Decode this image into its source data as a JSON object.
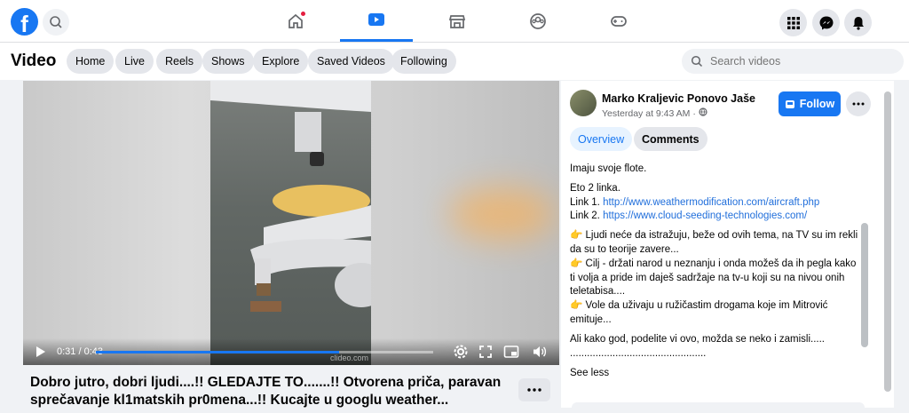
{
  "app": {
    "logo_letter": "f",
    "nav_tabs": [
      {
        "name": "home",
        "icon": "home-icon",
        "active": false,
        "notification": true
      },
      {
        "name": "video",
        "icon": "video-icon",
        "active": true
      },
      {
        "name": "marketplace",
        "icon": "marketplace-icon",
        "active": false
      },
      {
        "name": "groups",
        "icon": "groups-icon",
        "active": false
      },
      {
        "name": "gaming",
        "icon": "gaming-icon",
        "active": false
      }
    ],
    "right_icons": [
      "menu-grid-icon",
      "messenger-icon",
      "bell-icon"
    ]
  },
  "video_nav": {
    "title": "Video",
    "pills": [
      "Home",
      "Live",
      "Reels",
      "Shows",
      "Explore",
      "Saved Videos",
      "Following"
    ],
    "search_placeholder": "Search videos"
  },
  "player": {
    "time": "0:31 / 0:43",
    "progress_percent": 72,
    "watermark": "clideo.com"
  },
  "video_title": "Dobro jutro, dobri ljudi....!! GLEDAJTE TO.......!! Otvorena priča, paravan sprečavanje kl1matskih pr0mena...!! Kucajte u googlu weather...",
  "sidebar": {
    "author": "Marko Kraljevic Ponovo Jaše",
    "meta": "Yesterday at 9:43 AM ·",
    "follow_label": "Follow",
    "tabs": [
      "Overview",
      "Comments"
    ],
    "description": {
      "line1": "Imaju svoje flote.",
      "line2": "Eto 2 linka.",
      "link1_prefix": "Link 1.",
      "link1": "http://www.weathermodification.com/aircraft.php",
      "link2_prefix": "Link 2.",
      "link2": "https://www.cloud-seeding-technologies.com/",
      "bullet1": "👉 Ljudi neće da istražuju, beže od ovih tema, na TV su im rekli da su to teorije zavere...",
      "bullet2": "👉 Cilj - držati narod u neznanju i onda možeš da ih pegla kako ti volja a pride im daješ sadržaje na tv-u koji su na nivou onih teletabisa....",
      "bullet3": "👉 Vole da uživaju u ružičastim drogama koje im Mitrović emituje...",
      "line3": "Ali kako god, podelite vi ovo, možda se neko i zamisli.....",
      "dots1": "................................................",
      "dots2": "..........................................."
    },
    "see_less": "See less"
  },
  "colors": {
    "accent": "#1877f2",
    "notification": "#e41e3f"
  }
}
